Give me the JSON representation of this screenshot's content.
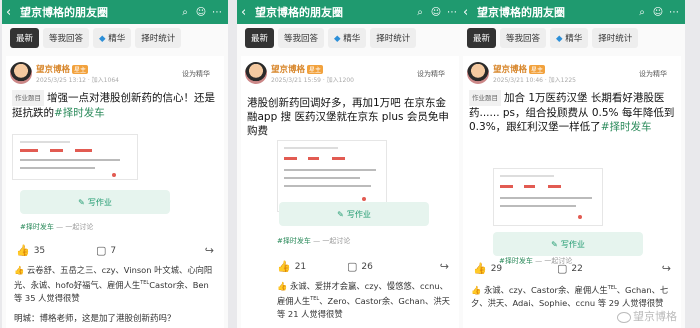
{
  "common": {
    "app_title": "望京博格的朋友圈",
    "tabs": [
      "最新",
      "等我回答",
      "精华",
      "择时统计"
    ],
    "author": "望京博格",
    "badge": "星主",
    "set_featured": "设为精华",
    "homework_tag": "作业题目",
    "write_button": "写作业",
    "hashtag": "#择时发车",
    "discuss": "一起讨论"
  },
  "panels": [
    {
      "meta": "2025/3/25 13:12 · 加入1064",
      "post_title": "增强一点对港股创新药的信心！还是挺抗跌的",
      "post_hashtag": "#择时发车",
      "likes": "35",
      "comments": "7",
      "liked_by": "云卷舒、五岳之三、czy、Vinson 叶文城、心向阳光、永诚、hofo好福气、雇佣人生",
      "liked_by_tail": "Castor余、Ben 等 35 人觉得很赞",
      "comment_preview": "明城：博格老师，这是加了港股创新药吗？"
    },
    {
      "meta": "2025/3/21 15:59 · 加入1200",
      "post_title": "港股创新药回调好多，再加1万吧 在京东金融app 搜 医药汉堡就在京东 plus 会员免申购费",
      "post_hashtag": "#择时发车",
      "likes": "21",
      "comments": "26",
      "liked_by": "永诚、爱拼才会赢、czy、慢悠悠、ccnu、雇佣人生",
      "liked_by_tail": "、Zero、Castor余、Gchan、洪天 等 21 人觉得很赞",
      "comment_preview": ""
    },
    {
      "meta": "2025/3/21 10:46 · 加入1225",
      "post_title": "加合 1万医药汉堡 长期看好港股医药...... ps，组合投顾费从 0.5% 每年降低到 0.3%，跟红利汉堡一样低了",
      "post_hashtag": "#择时发车",
      "likes": "29",
      "comments": "22",
      "liked_by": "永诚、czy、Castor余、雇佣人生",
      "liked_by_tail": "、Gchan、七夕、洪天、Adai、Sophie、ccnu 等 29 人觉得很赞",
      "comment_preview": ""
    }
  ],
  "watermark": "望京博格"
}
